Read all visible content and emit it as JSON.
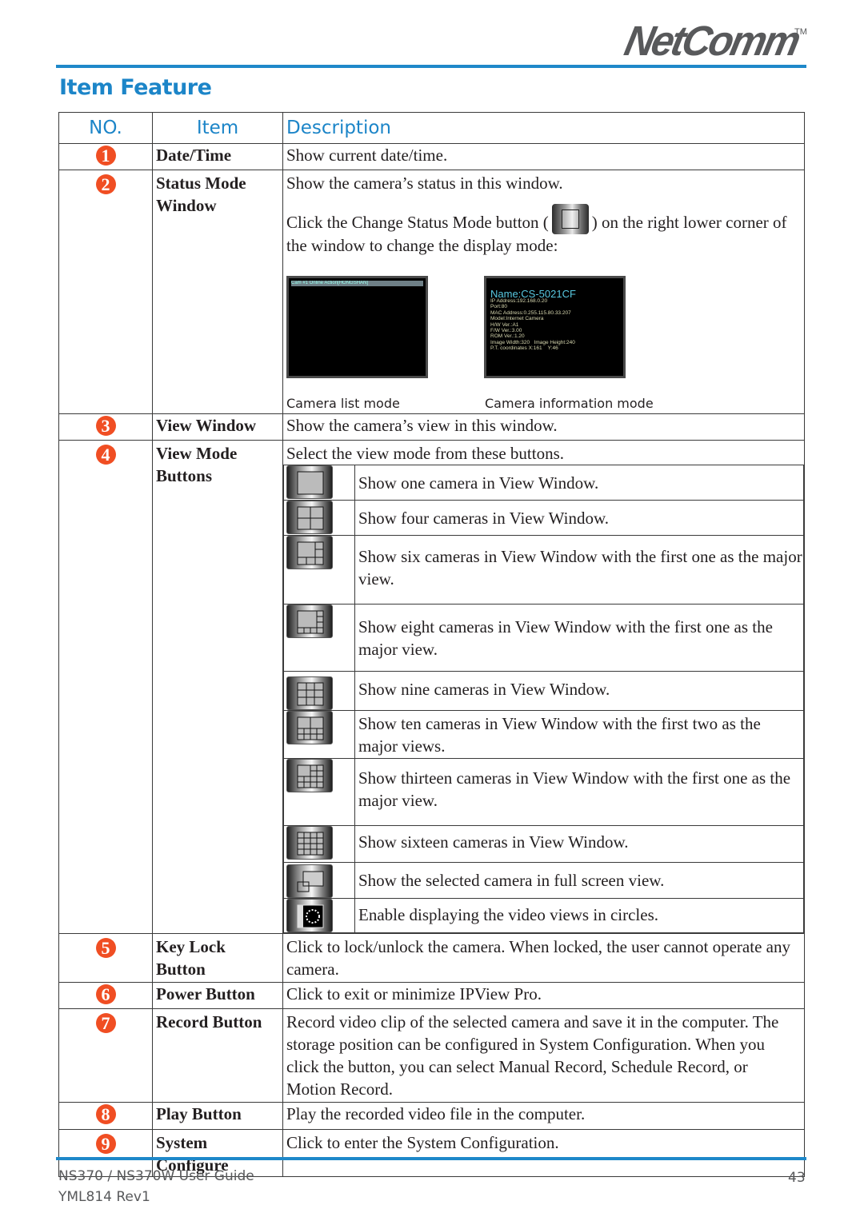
{
  "header": {
    "logo_text": "NetComm",
    "logo_tm": "TM",
    "accent_color": "#1c85c8",
    "badge_color": "#f04e23"
  },
  "page_title": "Item Feature",
  "table": {
    "columns": [
      "NO.",
      "Item",
      "Description"
    ],
    "rows": [
      {
        "no": "1",
        "item": "Date/Time",
        "desc": "Show current date/time."
      },
      {
        "no": "2",
        "item": "Status Mode Window",
        "desc": "Show the camera’s status in this window.",
        "desc2_before": "Click the Change Status Mode button (",
        "desc2_icon": "change-status-mode-icon",
        "desc2_after": ") on the right lower corner of the window to change the display mode:",
        "screens": [
          {
            "caption": "Camera list mode",
            "bar_text": "Cam #1    Online    Action[HONGSHAN]"
          },
          {
            "caption": "Camera information mode",
            "name": "Name:CS-5021CF",
            "info": "IP Address:192.168.0.20\nPort:80\nMAC Address:0.255.115.80.33.207\nModel:Internet Camera\nH/W Ver.:A1\nF/W Ver.:3.00\nROM Ver.:1.20\nImage Width:320   Image Height:240\nP.T. coordinates X:161    Y:46"
          }
        ]
      },
      {
        "no": "3",
        "item": "View Window",
        "desc": "Show the camera’s view in this window."
      },
      {
        "no": "4",
        "item": "View Mode Buttons",
        "desc": "Select the view mode from these buttons.",
        "view_modes": [
          {
            "icon": "single-view-icon",
            "text": "Show one camera in View Window."
          },
          {
            "icon": "quad-view-icon",
            "text": "Show four cameras in View Window."
          },
          {
            "icon": "six-view-icon",
            "text": "Show six cameras in View Window with the first one as the major view."
          },
          {
            "icon": "eight-view-icon",
            "text": "Show eight cameras in View Window with the first one as the major view."
          },
          {
            "icon": "nine-view-icon",
            "text": "Show nine cameras in View Window."
          },
          {
            "icon": "ten-view-icon",
            "text": "Show ten cameras in View Window with the first two as the major views."
          },
          {
            "icon": "thirteen-view-icon",
            "text": "Show thirteen cameras in View Window with the first one as the major view."
          },
          {
            "icon": "sixteen-view-icon",
            "text": "Show sixteen cameras in View Window."
          },
          {
            "icon": "full-screen-icon",
            "text": "Show the selected camera in full screen view."
          },
          {
            "icon": "circle-sequence-icon",
            "text": "Enable displaying the video views in circles."
          }
        ]
      },
      {
        "no": "5",
        "item": "Key Lock Button",
        "desc": "Click to lock/unlock the camera.  When locked, the user cannot operate any camera."
      },
      {
        "no": "6",
        "item": "Power Button",
        "desc": "Click to exit or minimize IPView Pro."
      },
      {
        "no": "7",
        "item": "Record Button",
        "desc": "Record video clip of the selected camera and save it in the computer. The storage position can be configured in System Configuration. When you click the button, you can select Manual Record, Schedule Record, or Motion Record."
      },
      {
        "no": "8",
        "item": "Play Button",
        "desc": "Play the recorded video file in the computer."
      },
      {
        "no": "9",
        "item": "System Configure",
        "desc": "Click to enter the System Configuration."
      }
    ]
  },
  "footer": {
    "guide": "NS370 / NS370W User Guide",
    "rev": "YML814 Rev1",
    "page": "43"
  }
}
